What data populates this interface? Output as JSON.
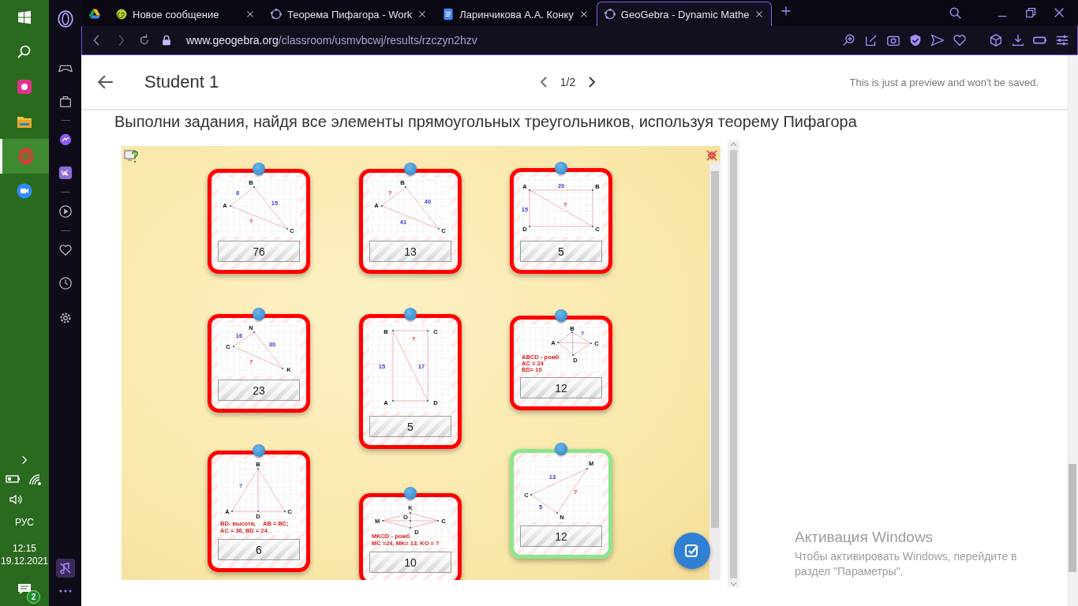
{
  "taskbar": {
    "language": "РУС",
    "time": "12:15",
    "date": "19.12.2021",
    "notifications": "2"
  },
  "tabs": [
    {
      "kind": "pinned",
      "selected": false
    },
    {
      "kind": "page",
      "title": "Новое сообщение",
      "selected": false
    },
    {
      "kind": "page",
      "title": "Теорема Пифагора - Work",
      "selected": false
    },
    {
      "kind": "page",
      "title": "Ларинчикова А.А. Конку",
      "selected": false
    },
    {
      "kind": "page",
      "title": "GeoGebra - Dynamic Mathe",
      "selected": true
    }
  ],
  "address": {
    "host": "www.geogebra.org",
    "path": "/classroom/usmvbcwj/results/rzczyn2hzv"
  },
  "header": {
    "title": "Student 1",
    "page": "1/2",
    "notice": "This is just a preview and won't be saved."
  },
  "instruction": "Выполни задания, найдя все элементы прямоугольных треугольников, используя теорему Пифагора",
  "cards": [
    {
      "answer": "76",
      "correct": false,
      "figure": {
        "labels": [
          "A",
          "B",
          "C",
          "8",
          "15",
          "?"
        ]
      }
    },
    {
      "answer": "23",
      "correct": false,
      "figure": {
        "labels": [
          "N",
          "16",
          "C",
          "30",
          "?",
          "K"
        ]
      }
    },
    {
      "answer": "6",
      "correct": false,
      "figure": {
        "labels": [
          "B",
          "?",
          "A",
          "C",
          "D",
          "BD- высота,",
          "AB = BC;",
          "AC = 36, BD = 24."
        ]
      }
    },
    {
      "answer": "13",
      "correct": false,
      "figure": {
        "labels": [
          "A",
          "B",
          "C",
          "?",
          "40",
          "41"
        ]
      }
    },
    {
      "answer": "5",
      "correct": false,
      "figure": {
        "labels": [
          "B",
          "C",
          "?",
          "15",
          "17",
          "A",
          "D"
        ]
      }
    },
    {
      "answer": "10",
      "correct": false,
      "figure": {
        "labels": [
          "K",
          "M",
          "O",
          "C",
          "D",
          "MKCD - ромб",
          "MC =24, MK= 13. KO = ?"
        ]
      }
    },
    {
      "answer": "5",
      "correct": false,
      "figure": {
        "labels": [
          "A",
          "20",
          "B",
          "15",
          "?",
          "D",
          "C"
        ]
      }
    },
    {
      "answer": "12",
      "correct": false,
      "figure": {
        "labels": [
          "B",
          "?",
          "A",
          "C",
          "ABCD - ромб",
          "AC = 24",
          "BD= 10",
          "D"
        ]
      }
    },
    {
      "answer": "12",
      "correct": true,
      "figure": {
        "labels": [
          "M",
          "13",
          "C",
          "?",
          "5",
          "N"
        ]
      }
    }
  ],
  "activation": {
    "title": "Активация Windows",
    "text": "Чтобы активировать Windows, перейдите в раздел \"Параметры\"."
  }
}
